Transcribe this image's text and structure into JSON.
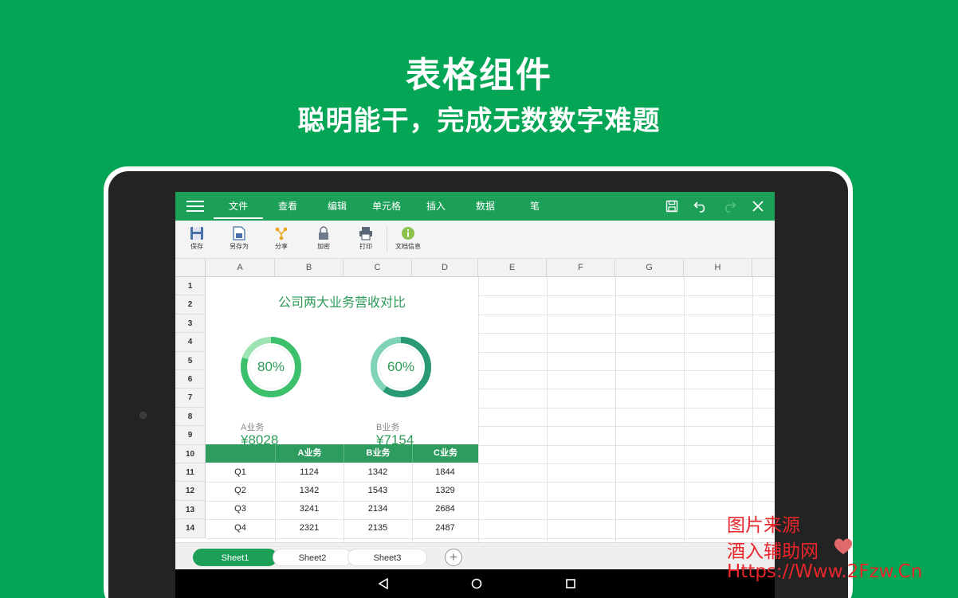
{
  "promo": {
    "title": "表格组件",
    "subtitle": "聪明能干，完成无数数字难题"
  },
  "topbar": {
    "tabs": [
      "文件",
      "查看",
      "编辑",
      "单元格",
      "插入",
      "数据",
      "笔"
    ],
    "active_tab": "文件",
    "actions": [
      "save-icon",
      "undo-icon",
      "redo-icon",
      "close-icon"
    ]
  },
  "ribbon": {
    "items": [
      {
        "label": "保存",
        "icon": "save-icon"
      },
      {
        "label": "另存为",
        "icon": "save-as-icon"
      },
      {
        "label": "分享",
        "icon": "share-icon"
      },
      {
        "label": "加密",
        "icon": "lock-icon"
      },
      {
        "label": "打印",
        "icon": "print-icon"
      },
      {
        "label": "文档信息",
        "icon": "info-icon"
      }
    ]
  },
  "sheet": {
    "columns": [
      "A",
      "B",
      "C",
      "D",
      "E",
      "F",
      "G",
      "H"
    ],
    "rows": [
      "1",
      "2",
      "3",
      "4",
      "5",
      "6",
      "7",
      "8",
      "9",
      "10",
      "11",
      "12",
      "13",
      "14"
    ],
    "chart_title": "公司两大业务营收对比",
    "donuts": [
      {
        "percent_label": "80%",
        "value": 0.8,
        "label": "A业务",
        "amount": "¥8028",
        "color": "#3cc06c"
      },
      {
        "percent_label": "60%",
        "value": 0.6,
        "label": "B业务",
        "amount": "¥7154",
        "color": "#2a9a72"
      }
    ],
    "table_header": [
      "",
      "A业务",
      "B业务",
      "C业务"
    ],
    "table_rows": [
      [
        "Q1",
        "1124",
        "1342",
        "1844"
      ],
      [
        "Q2",
        "1342",
        "1543",
        "1329"
      ],
      [
        "Q3",
        "3241",
        "2134",
        "2684"
      ],
      [
        "Q4",
        "2321",
        "2135",
        "2487"
      ]
    ]
  },
  "sheets": {
    "tabs": [
      "Sheet1",
      "Sheet2",
      "Sheet3"
    ],
    "active": "Sheet1",
    "add_label": "+"
  },
  "watermark": {
    "line1": "图片来源",
    "line2": "酒入辅助网",
    "line3": "Https://Www.2Fzw.Cn"
  },
  "colors": {
    "background": "#04a554",
    "toolbar": "#1ca057",
    "header_fill": "#2f9c5f"
  }
}
